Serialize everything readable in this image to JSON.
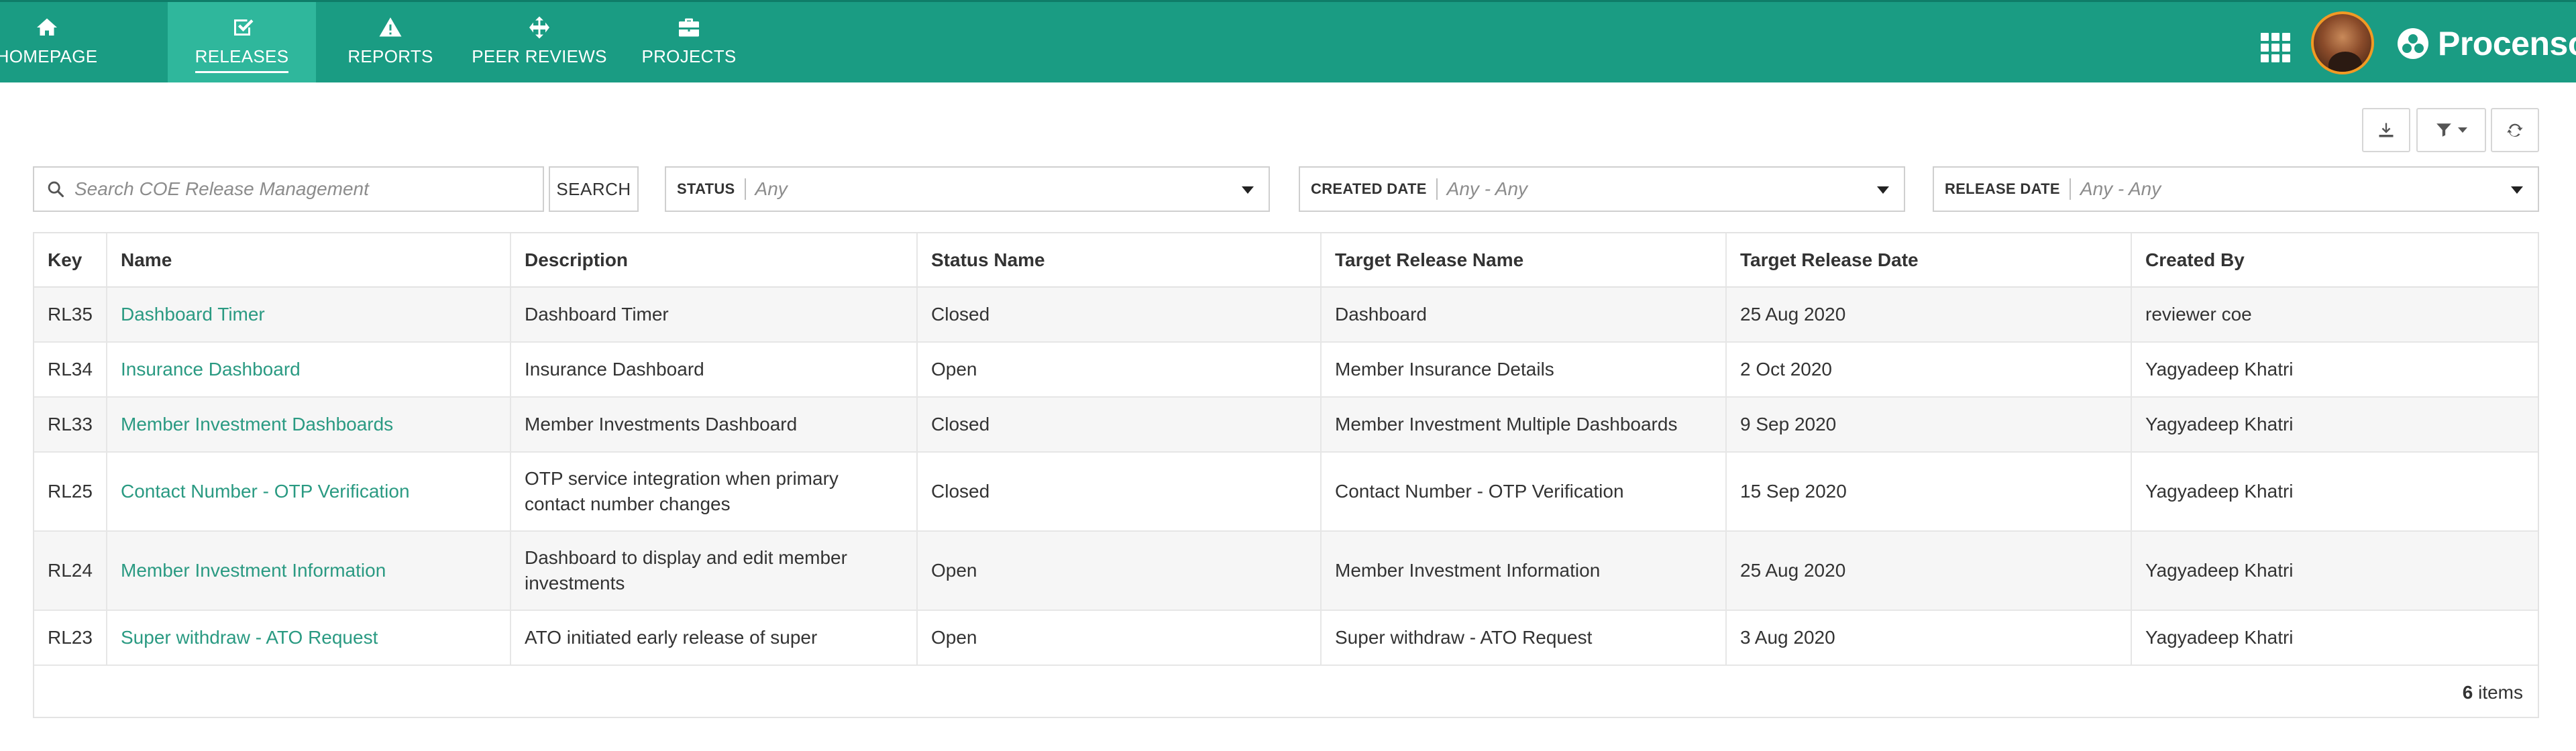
{
  "nav": {
    "items": [
      {
        "label": "HOMEPAGE",
        "icon": "home-icon"
      },
      {
        "label": "RELEASES",
        "icon": "check-square-icon"
      },
      {
        "label": "REPORTS",
        "icon": "warning-icon"
      },
      {
        "label": "PEER REVIEWS",
        "icon": "move-arrows-icon"
      },
      {
        "label": "PROJECTS",
        "icon": "briefcase-icon"
      }
    ],
    "active": "RELEASES"
  },
  "header": {
    "brand": "Procensol",
    "apps_icon": "apps-grid-icon",
    "avatar_icon": "user-avatar"
  },
  "toolbar": {
    "download_icon": "download-icon",
    "filter_icon": "filter-icon",
    "refresh_icon": "refresh-icon"
  },
  "search": {
    "placeholder": "Search COE Release Management",
    "value": "",
    "button_label": "SEARCH"
  },
  "filters": [
    {
      "label": "STATUS",
      "value": "Any"
    },
    {
      "label": "CREATED DATE",
      "value": "Any - Any"
    },
    {
      "label": "RELEASE DATE",
      "value": "Any - Any"
    }
  ],
  "table": {
    "columns": [
      "Key",
      "Name",
      "Description",
      "Status Name",
      "Target Release Name",
      "Target Release Date",
      "Created By"
    ],
    "rows": [
      {
        "key": "RL35",
        "name": "Dashboard Timer",
        "description": "Dashboard Timer",
        "status": "Closed",
        "target_name": "Dashboard",
        "target_date": "25 Aug 2020",
        "created_by": "reviewer coe"
      },
      {
        "key": "RL34",
        "name": "Insurance Dashboard",
        "description": "Insurance Dashboard",
        "status": "Open",
        "target_name": "Member Insurance Details",
        "target_date": "2 Oct 2020",
        "created_by": "Yagyadeep Khatri"
      },
      {
        "key": "RL33",
        "name": "Member Investment Dashboards",
        "description": "Member Investments Dashboard",
        "status": "Closed",
        "target_name": "Member Investment Multiple Dashboards",
        "target_date": "9 Sep 2020",
        "created_by": "Yagyadeep Khatri"
      },
      {
        "key": "RL25",
        "name": "Contact Number - OTP Verification",
        "description": "OTP service integration when primary contact number changes",
        "status": "Closed",
        "target_name": "Contact Number - OTP Verification",
        "target_date": "15 Sep 2020",
        "created_by": "Yagyadeep Khatri"
      },
      {
        "key": "RL24",
        "name": "Member Investment Information",
        "description": "Dashboard to display and edit member investments",
        "status": "Open",
        "target_name": "Member Investment Information",
        "target_date": "25 Aug 2020",
        "created_by": "Yagyadeep Khatri"
      },
      {
        "key": "RL23",
        "name": "Super withdraw - ATO Request",
        "description": "ATO initiated early release of super",
        "status": "Open",
        "target_name": "Super withdraw - ATO Request",
        "target_date": "3 Aug 2020",
        "created_by": "Yagyadeep Khatri"
      }
    ]
  },
  "pager": {
    "count": "6",
    "suffix": "items"
  },
  "colors": {
    "brand": "#1a9c83",
    "active_tab": "#2fb79c",
    "link": "#2a9a82",
    "avatar_ring": "#f19a24"
  }
}
